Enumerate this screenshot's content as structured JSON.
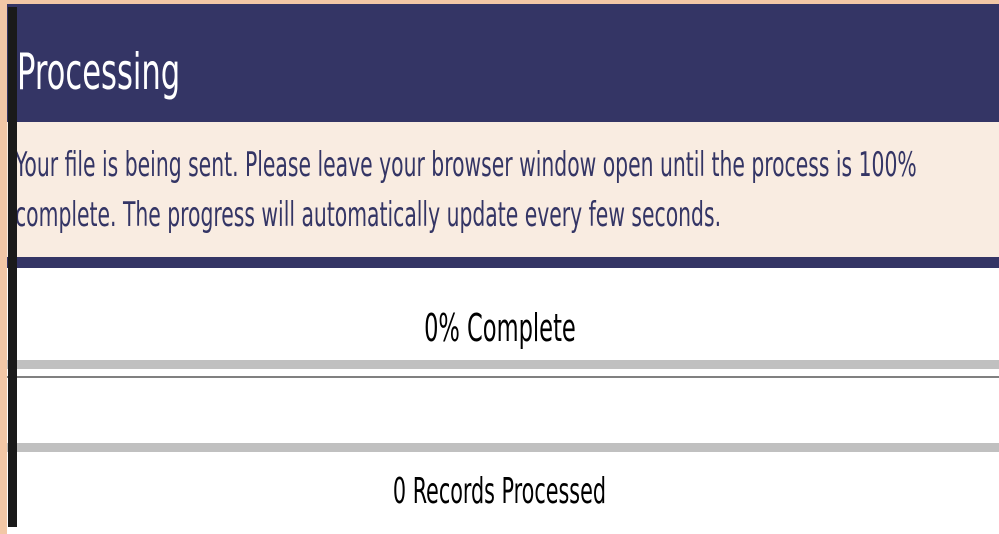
{
  "dialog": {
    "title": "Processing",
    "message": "Your file is being sent. Please leave your browser window open until the process is 100%\ncomplete. The progress will automatically update every few seconds."
  },
  "progress": {
    "percent_label": "0% Complete",
    "value_percent": 0,
    "records_label": "0 Records Processed"
  },
  "colors": {
    "header_bg": "#343565",
    "message_bg": "#f9ece1",
    "message_text": "#343565",
    "frame_edge": "#f2c7a6",
    "progress_border": "#c0c0c0"
  }
}
